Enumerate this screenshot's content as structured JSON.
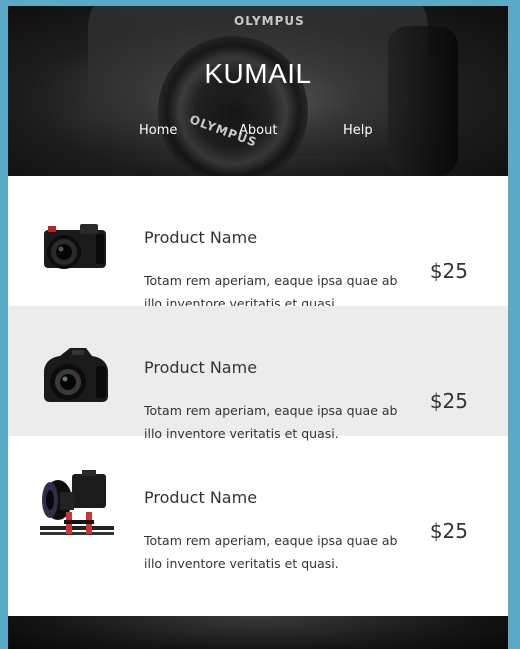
{
  "site": {
    "title": "KUMAIL",
    "hero_brand": "OLYMPUS"
  },
  "nav": [
    {
      "label": "Home"
    },
    {
      "label": "About"
    },
    {
      "label": "Help"
    }
  ],
  "products": [
    {
      "name": "Product Name",
      "desc": "Totam rem aperiam, eaque ipsa quae ab illo inventore veritatis et quasi.",
      "price": "$25",
      "icon": "mirrorless-camera-icon"
    },
    {
      "name": "Product Name",
      "desc": "Totam rem aperiam, eaque ipsa quae ab illo inventore veritatis et quasi.",
      "price": "$25",
      "icon": "bridge-camera-icon"
    },
    {
      "name": "Product Name",
      "desc": "Totam rem aperiam, eaque ipsa quae ab illo inventore veritatis et quasi.",
      "price": "$25",
      "icon": "video-camera-rig-icon"
    }
  ],
  "colors": {
    "page_background": "#5aaac6",
    "alt_row": "#ececec",
    "text": "#333333"
  }
}
